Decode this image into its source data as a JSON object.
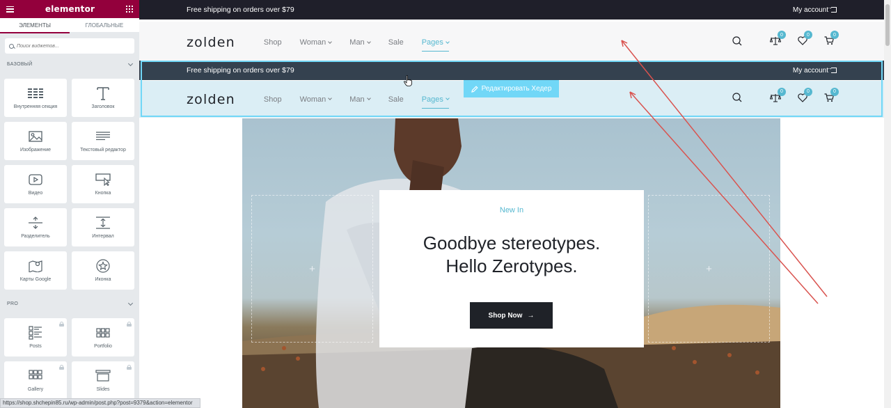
{
  "panel": {
    "logo": "elementor",
    "tabs": [
      "ЭЛЕМЕНТЫ",
      "ГЛОБАЛЬНЫЕ"
    ],
    "search_placeholder": "Поиск виджетов...",
    "categories": {
      "basic": "БАЗОВЫЙ",
      "pro": "PRO"
    },
    "widgets": [
      {
        "label": "Внутренняя секция",
        "icon": "inner-section-icon"
      },
      {
        "label": "Заголовок",
        "icon": "heading-icon"
      },
      {
        "label": "Изображение",
        "icon": "image-icon"
      },
      {
        "label": "Текстовый редактор",
        "icon": "text-editor-icon"
      },
      {
        "label": "Видео",
        "icon": "video-icon"
      },
      {
        "label": "Кнопка",
        "icon": "button-icon"
      },
      {
        "label": "Разделитель",
        "icon": "divider-icon"
      },
      {
        "label": "Интервал",
        "icon": "spacer-icon"
      },
      {
        "label": "Карты Google",
        "icon": "google-maps-icon"
      },
      {
        "label": "Иконка",
        "icon": "star-icon"
      }
    ],
    "pro_widgets": [
      {
        "label": "Posts",
        "icon": "posts-icon",
        "locked": true
      },
      {
        "label": "Portfolio",
        "icon": "portfolio-icon",
        "locked": true
      },
      {
        "label": "Gallery",
        "icon": "gallery-icon",
        "locked": true
      },
      {
        "label": "Slides",
        "icon": "slides-icon",
        "locked": true
      }
    ]
  },
  "site": {
    "topbar": {
      "shipping_text": "Free shipping on orders over $79",
      "account_label": "My account"
    },
    "nav": {
      "brand": "zolden",
      "items": [
        {
          "label": "Shop",
          "dropdown": false
        },
        {
          "label": "Woman",
          "dropdown": true
        },
        {
          "label": "Man",
          "dropdown": true
        },
        {
          "label": "Sale",
          "dropdown": false
        },
        {
          "label": "Pages",
          "dropdown": true,
          "active": true
        }
      ],
      "compare_count": "0",
      "wishlist_count": "0",
      "cart_count": "0"
    },
    "edit_header_label": "Редактировать Хедер",
    "hero": {
      "eyebrow": "New In",
      "headline_line1": "Goodbye stereotypes.",
      "headline_line2": "Hello Zerotypes.",
      "cta_label": "Shop Now"
    }
  },
  "status_url": "https://shop.shchepin85.ru/wp-admin/post.php?post=9379&action=elementor",
  "colors": {
    "elementor_brand": "#93003c",
    "accent": "#56b8d0",
    "topbar_dark": "#1f1f2a",
    "topbar_hover": "#34414f",
    "header_hover_bg": "#dbeef5",
    "section_outline": "#71d7f7",
    "annotation_arrow": "#d9534f"
  }
}
